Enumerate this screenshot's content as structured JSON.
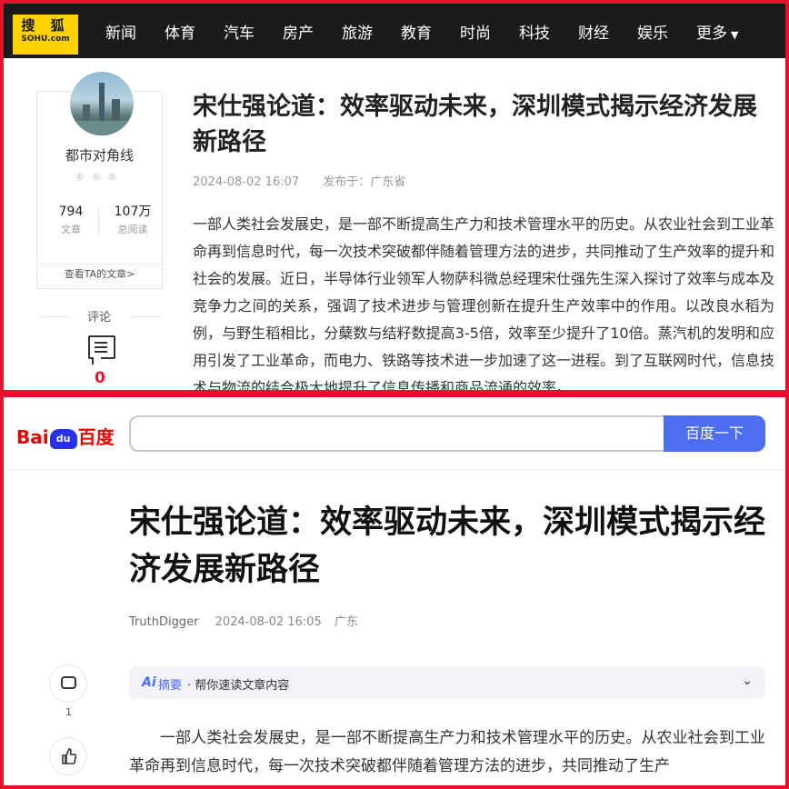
{
  "sohu": {
    "logo_line1": "搜 狐",
    "logo_line2": "SOHU.com",
    "nav": [
      "新闻",
      "体育",
      "汽车",
      "房产",
      "旅游",
      "教育",
      "时尚",
      "科技",
      "财经",
      "娱乐"
    ],
    "nav_more": "更多",
    "author": {
      "name": "都市对角线",
      "medals": "♔♔♔",
      "articles_num": "794",
      "articles_label": "文章",
      "reads_num": "107万",
      "reads_label": "总阅读",
      "view_link": "查看TA的文章>"
    },
    "comment_label": "评论",
    "comment_count": "0",
    "title": "宋仕强论道：效率驱动未来，深圳模式揭示经济发展新路径",
    "date": "2024-08-02 16:07",
    "published_in": "发布于：广东省",
    "body": "一部人类社会发展史，是一部不断提高生产力和技术管理水平的历史。从农业社会到工业革命再到信息时代，每一次技术突破都伴随着管理方法的进步，共同推动了生产效率的提升和社会的发展。近日，半导体行业领军人物萨科微总经理宋仕强先生深入探讨了效率与成本及竞争力之间的关系，强调了技术进步与管理创新在提升生产效率中的作用。以改良水稻为例，与野生稻相比，分蘖数与结籽数提高3-5倍，效率至少提升了10倍。蒸汽机的发明和应用引发了工业革命，而电力、铁路等技术进一步加速了这一进程。到了互联网时代，信息技术与物流的结合极大地提升了信息传播和商品流通的效率。"
  },
  "baidu": {
    "logo_left": "Bai",
    "logo_paw": "du",
    "logo_right": "百度",
    "search_value": "",
    "search_button": "百度一下",
    "title": "宋仕强论道：效率驱动未来，深圳模式揭示经济发展新路径",
    "author": "TruthDigger",
    "date": "2024-08-02 16:05",
    "location": "广东",
    "comment_count": "1",
    "ai_label": "Ai",
    "ai_title": "摘要",
    "ai_desc": "· 帮你速读文章内容",
    "body": "一部人类社会发展史，是一部不断提高生产力和技术管理水平的历史。从农业社会到工业革命再到信息时代，每一次技术突破都伴随着管理方法的进步，共同推动了生产"
  },
  "colors": {
    "frame": "#e8112d",
    "sohu_yellow": "#ffd200",
    "baidu_blue": "#4e6ef2",
    "baidu_red": "#e10601"
  }
}
